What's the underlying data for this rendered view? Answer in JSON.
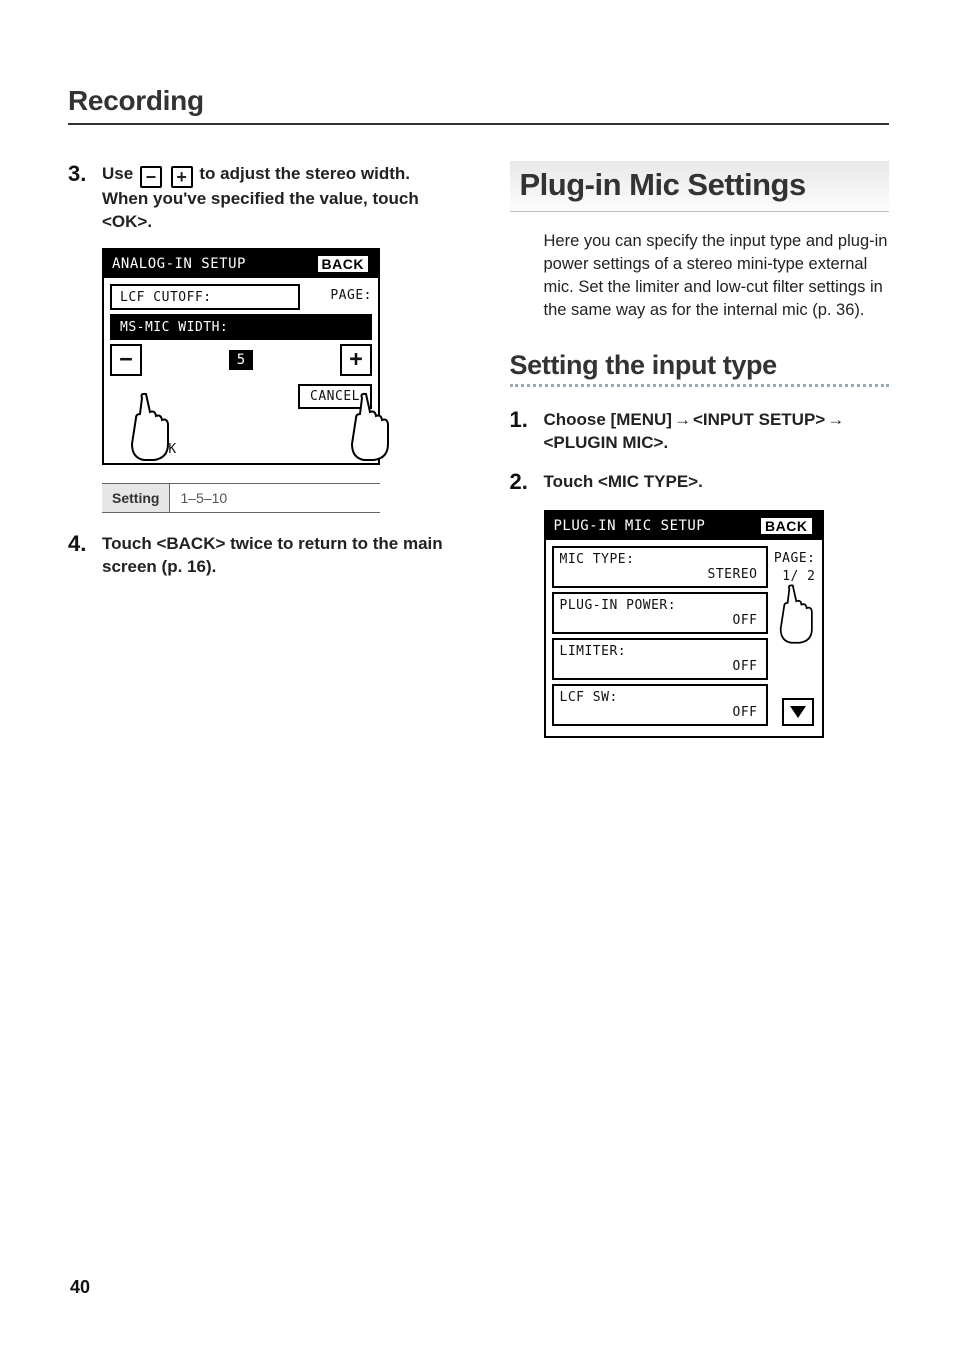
{
  "page_title": "Recording",
  "page_number": "40",
  "left": {
    "step3": {
      "num": "3.",
      "text_pre": "Use ",
      "text_mid": " to adjust the stereo width. When you've specified the value, touch <OK>.",
      "minus": "−",
      "plus": "+"
    },
    "lcd1": {
      "title": "ANALOG-IN SETUP",
      "back": "BACK",
      "row_lcf": "LCF CUTOFF:",
      "page_label": "PAGE:",
      "row_ms": "MS-MIC WIDTH:",
      "minus": "−",
      "value": "5",
      "plus": "+",
      "ok": "OK",
      "cancel": "CANCEL"
    },
    "setting_table": {
      "label": "Setting",
      "value": "1–5–10"
    },
    "step4": {
      "num": "4.",
      "text": "Touch <BACK> twice to return to the main screen (p. 16)."
    }
  },
  "right": {
    "main_heading": "Plug-in Mic Settings",
    "intro": "Here you can specify the input type and plug-in power settings of a stereo mini-type external mic. Set the limiter and low-cut filter settings in the same way as for the internal mic (p. 36).",
    "subheading": "Setting the input type",
    "step1": {
      "num": "1.",
      "text_a": "Choose [MENU]",
      "arrow": "→",
      "text_b": "<INPUT SETUP>",
      "text_c": "<PLUGIN  MIC>."
    },
    "step2": {
      "num": "2.",
      "text": "Touch <MIC TYPE>."
    },
    "lcd2": {
      "title": "PLUG-IN MIC SETUP",
      "back": "BACK",
      "row_mic_label": "MIC TYPE:",
      "row_mic_value": "STEREO",
      "page_label": "PAGE:",
      "page_value": "1/ 2",
      "row_power_label": "PLUG-IN POWER:",
      "row_power_value": "OFF",
      "row_limiter_label": "LIMITER:",
      "row_limiter_value": "OFF",
      "row_lcf_label": "LCF SW:",
      "row_lcf_value": "OFF"
    }
  }
}
